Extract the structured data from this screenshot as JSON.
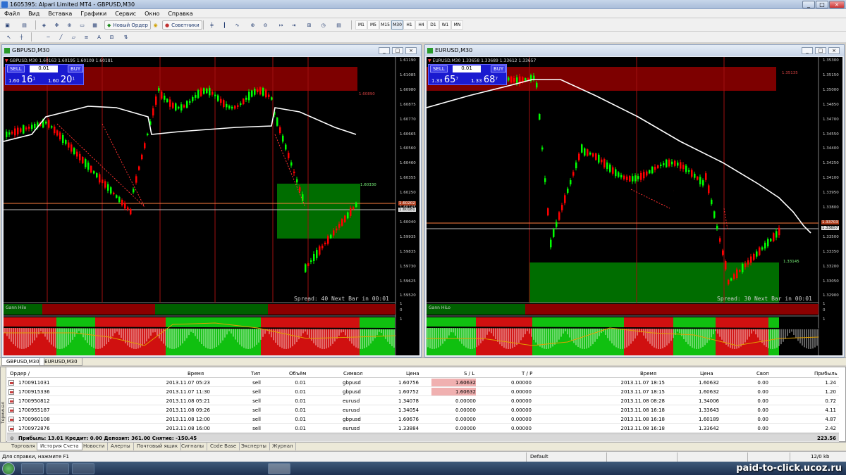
{
  "window": {
    "title": "1605395: Alpari Limited MT4 - GBPUSD,M30"
  },
  "menu": [
    "Файл",
    "Вид",
    "Вставка",
    "Графики",
    "Сервис",
    "Окно",
    "Справка"
  ],
  "toolbar": {
    "new_order": "Новый Ордер",
    "advisors": "Советники"
  },
  "timeframes": [
    "M1",
    "M5",
    "M15",
    "M30",
    "H1",
    "H4",
    "D1",
    "W1",
    "MN"
  ],
  "active_timeframe": "M30",
  "charts": [
    {
      "window_title": "GBPUSD,M30",
      "ohlc": "GBPUSD,M30  1.60163 1.60195 1.60109 1.60181",
      "sell": "SELL",
      "buy": "BUY",
      "lot": "0.01",
      "bid_prefix": "1.60",
      "bid_big": "16",
      "bid_sup": "1",
      "ask_prefix": "1.60",
      "ask_big": "20",
      "ask_sup": "1",
      "spread_text": "Spread: 40  Next Bar in 00:01",
      "price_axis": [
        "1.61190",
        "1.61085",
        "1.60980",
        "1.60875",
        "1.60770",
        "1.60665",
        "1.60560",
        "1.60460",
        "1.60355",
        "1.60250",
        "1.60145",
        "1.60040",
        "1.59935",
        "1.59835",
        "1.59730",
        "1.59625",
        "1.59520"
      ],
      "level_labels": [
        "1.60890",
        "1.60330",
        "1.60202",
        "1.60181"
      ],
      "indicator1_label": "Gann Hilo",
      "indicator_scale": [
        "1",
        "0",
        "1"
      ]
    },
    {
      "window_title": "EURUSD,M30",
      "ohlc": "EURUSD,M30  1.33658 1.33689 1.33612 1.33657",
      "sell": "SELL",
      "buy": "BUY",
      "lot": "0.01",
      "bid_prefix": "1.33",
      "bid_big": "65",
      "bid_sup": "7",
      "ask_prefix": "1.33",
      "ask_big": "68",
      "ask_sup": "7",
      "spread_text": "Spread: 30  Next Bar in 00:01",
      "price_axis": [
        "1.35300",
        "1.35150",
        "1.35000",
        "1.34850",
        "1.34700",
        "1.34550",
        "1.34400",
        "1.34250",
        "1.34100",
        "1.33950",
        "1.33800",
        "1.33650",
        "1.33500",
        "1.33350",
        "1.33200",
        "1.33050",
        "1.32900"
      ],
      "level_labels": [
        "1.35135",
        "1.33703",
        "1.33657",
        "1.33145"
      ],
      "indicator1_label": "Gann HiLo",
      "indicator_scale": [
        "1",
        "0",
        "1"
      ]
    }
  ],
  "chart_tabs": [
    "GBPUSD,M30",
    "EURUSD,M30"
  ],
  "terminal": {
    "side_label": "Терминал",
    "headers": {
      "order": "Ордер  /",
      "time": "Время",
      "type": "Тип",
      "volume": "Объём",
      "symbol": "Символ",
      "price": "Цена",
      "sl": "S / L",
      "tp": "T / P",
      "close_time": "Время",
      "close_price": "Цена",
      "swap": "Своп",
      "profit": "Прибыль"
    },
    "rows": [
      {
        "order": "1700911031",
        "time": "2013.11.07 05:23",
        "type": "sell",
        "volume": "0.01",
        "symbol": "gbpusd",
        "price": "1.60756",
        "sl": "1.60632",
        "tp": "0.00000",
        "close_time": "2013.11.07 18:15",
        "close_price": "1.60632",
        "swap": "0.00",
        "profit": "1.24",
        "sl_hit": true
      },
      {
        "order": "1700915336",
        "time": "2013.11.07 11:30",
        "type": "sell",
        "volume": "0.01",
        "symbol": "gbpusd",
        "price": "1.60752",
        "sl": "1.60632",
        "tp": "0.00000",
        "close_time": "2013.11.07 18:15",
        "close_price": "1.60632",
        "swap": "0.00",
        "profit": "1.20",
        "sl_hit": true
      },
      {
        "order": "1700950812",
        "time": "2013.11.08 05:21",
        "type": "sell",
        "volume": "0.01",
        "symbol": "eurusd",
        "price": "1.34078",
        "sl": "0.00000",
        "tp": "0.00000",
        "close_time": "2013.11.08 08:28",
        "close_price": "1.34006",
        "swap": "0.00",
        "profit": "0.72",
        "sl_hit": false
      },
      {
        "order": "1700955187",
        "time": "2013.11.08 09:26",
        "type": "sell",
        "volume": "0.01",
        "symbol": "eurusd",
        "price": "1.34054",
        "sl": "0.00000",
        "tp": "0.00000",
        "close_time": "2013.11.08 16:18",
        "close_price": "1.33643",
        "swap": "0.00",
        "profit": "4.11",
        "sl_hit": false
      },
      {
        "order": "1700960108",
        "time": "2013.11.08 12:00",
        "type": "sell",
        "volume": "0.01",
        "symbol": "gbpusd",
        "price": "1.60676",
        "sl": "0.00000",
        "tp": "0.00000",
        "close_time": "2013.11.08 16:18",
        "close_price": "1.60189",
        "swap": "0.00",
        "profit": "4.87",
        "sl_hit": false
      },
      {
        "order": "1700972876",
        "time": "2013.11.08 16:00",
        "type": "sell",
        "volume": "0.01",
        "symbol": "eurusd",
        "price": "1.33884",
        "sl": "0.00000",
        "tp": "0.00000",
        "close_time": "2013.11.08 16:18",
        "close_price": "1.33642",
        "swap": "0.00",
        "profit": "2.42",
        "sl_hit": false
      }
    ],
    "total": "Прибыль: 13.01  Кредит: 0.00  Депозит: 361.00  Снятие: -150.45",
    "total_profit": "223.56"
  },
  "bottom_tabs": [
    "Торговля",
    "История Счета",
    "Новости",
    "Алерты",
    "Почтовый ящик",
    "Сигналы",
    "Code Base",
    "Эксперты",
    "Журнал"
  ],
  "active_bottom_tab": "История Счета",
  "status": {
    "help": "Для справки, нажмите F1",
    "profile": "Default",
    "traffic": "12/0 kb"
  },
  "watermark": "paid-to-click.ucoz.ru",
  "colors": {
    "bull": "#00ff00",
    "bear": "#ff0000",
    "zone_red": "#8b0000",
    "zone_green": "#008000",
    "ma_line": "#ffffff"
  }
}
